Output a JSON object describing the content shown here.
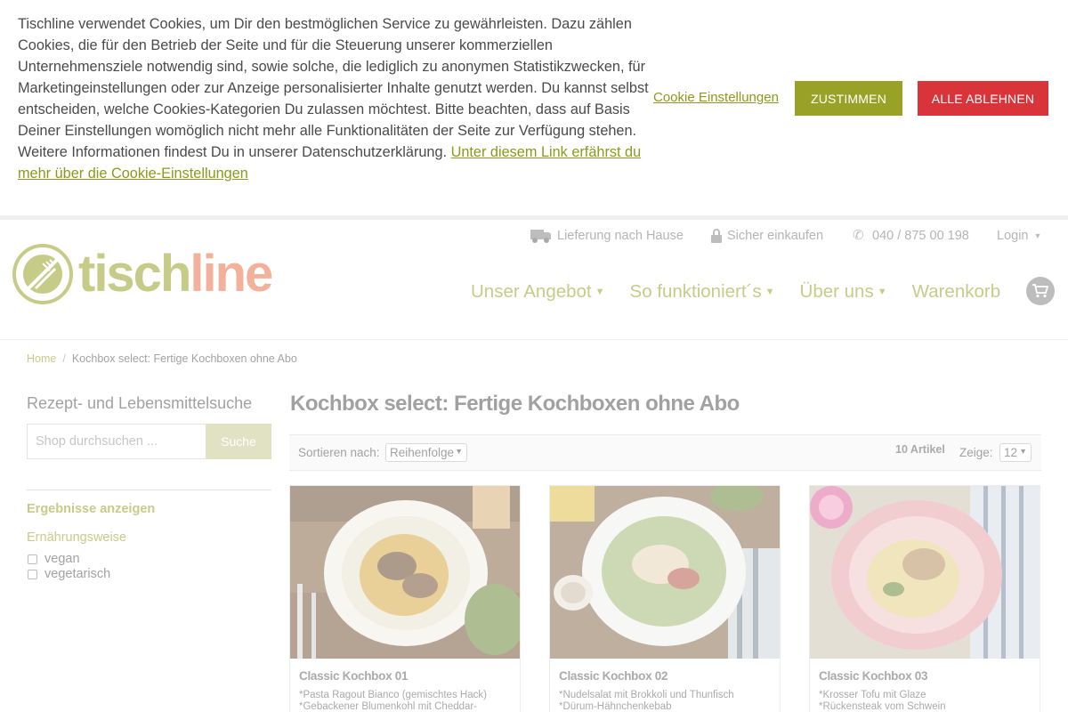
{
  "cookie": {
    "text": "Tischline verwendet Cookies, um Dir den bestmöglichen Service zu gewährleisten. Dazu zählen Cookies, die für den Betrieb der Seite und für die Steuerung unserer kommerziellen Unternehmensziele notwendig sind, sowie solche, die lediglich zu anonymen Statistikzwecken, für Marketingeinstellungen oder zur Anzeige personalisierter Inhalte genutzt werden. Du kannst selbst entscheiden, welche Cookies-Kategorien Du zulassen möchtest. Bitte beachten, dass auf Basis Deiner Einstellungen womöglich nicht mehr alle Funktionalitäten der Seite zur Verfügung stehen. Weitere Informationen findest Du in unserer Datenschutzerklärung.",
    "link": "Unter diesem Link erfährst du mehr über die Cookie-Einstellungen",
    "settings_label": "Cookie Einstellungen",
    "accept_label": "ZUSTIMMEN",
    "reject_label": "ALLE ABLEHNEN"
  },
  "header": {
    "logo_part1": "tisch",
    "logo_part2": "line",
    "topbar": {
      "delivery": "Lieferung nach Hause",
      "secure": "Sicher einkaufen",
      "phone": "040 / 875 00 198",
      "login": "Login"
    },
    "nav": [
      "Unser Angebot",
      "So funktioniert´s",
      "Über uns"
    ],
    "cart_label": "Warenkorb"
  },
  "breadcrumb": {
    "home": "Home",
    "separator": "/",
    "current": "Kochbox select: Fertige Kochboxen ohne Abo"
  },
  "sidebar": {
    "title": "Rezept- und Lebensmittelsuche",
    "search_placeholder": "Shop durchsuchen ...",
    "search_button": "Suche",
    "results_link": "Ergebnisse anzeigen",
    "filter_title": "Ernährungsweise",
    "options": [
      "vegan",
      "vegetarisch"
    ]
  },
  "main": {
    "title": "Kochbox select: Fertige Kochboxen ohne Abo",
    "sort_label": "Sortieren nach:",
    "sort_value": "Reihenfolge",
    "count": "10 Artikel",
    "show_label": "Zeige:",
    "show_value": "12",
    "products": [
      {
        "title": "Classic Kochbox 01",
        "line1": "*Pasta Ragout Bianco (gemischtes Hack)",
        "line2": "*Gebackener Blumenkohl mit Cheddar-"
      },
      {
        "title": "Classic Kochbox 02",
        "line1": "*Nudelsalat mit Brokkoli und Thunfisch",
        "line2": "*Dürum-Hähnchenkebab"
      },
      {
        "title": "Classic Kochbox 03",
        "line1": "*Krosser Tofu mit Glaze",
        "line2": "*Rückensteak vom Schwein"
      }
    ]
  },
  "colors": {
    "brand_green": "#9aa127",
    "brand_orange": "#e8724a",
    "reject_red": "#d9343a"
  }
}
